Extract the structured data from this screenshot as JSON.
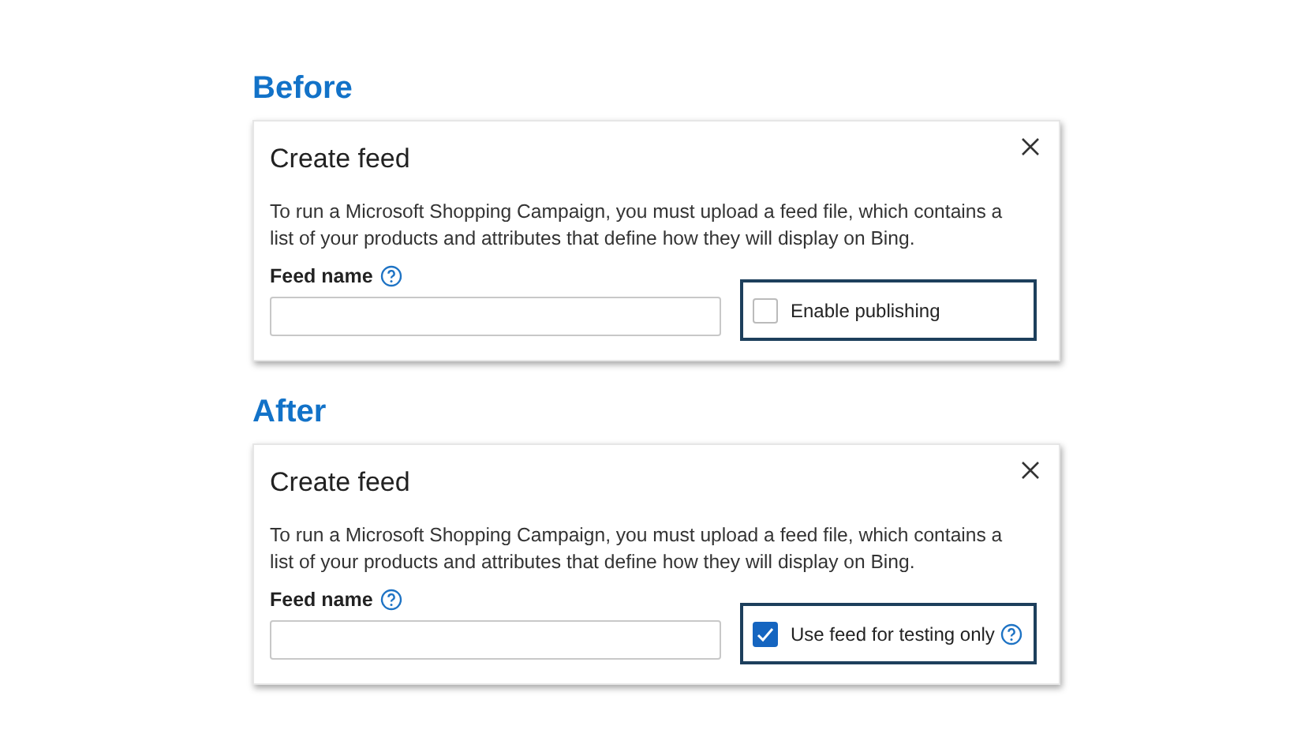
{
  "panels": [
    {
      "heading": "Before",
      "dialog": {
        "title": "Create feed",
        "description": "To run a Microsoft Shopping Campaign, you must upload a feed file, which contains a list of your products and attributes that define how they will display on Bing.",
        "field_label": "Feed name",
        "checkbox": {
          "label": "Enable publishing",
          "checked": false,
          "help": false
        }
      }
    },
    {
      "heading": "After",
      "dialog": {
        "title": "Create feed",
        "description": "To run a Microsoft Shopping Campaign, you must upload a feed file, which contains a list of your products and attributes that define how they will display on Bing.",
        "field_label": "Feed name",
        "checkbox": {
          "label": "Use feed for testing only",
          "checked": true,
          "help": true
        }
      }
    }
  ]
}
